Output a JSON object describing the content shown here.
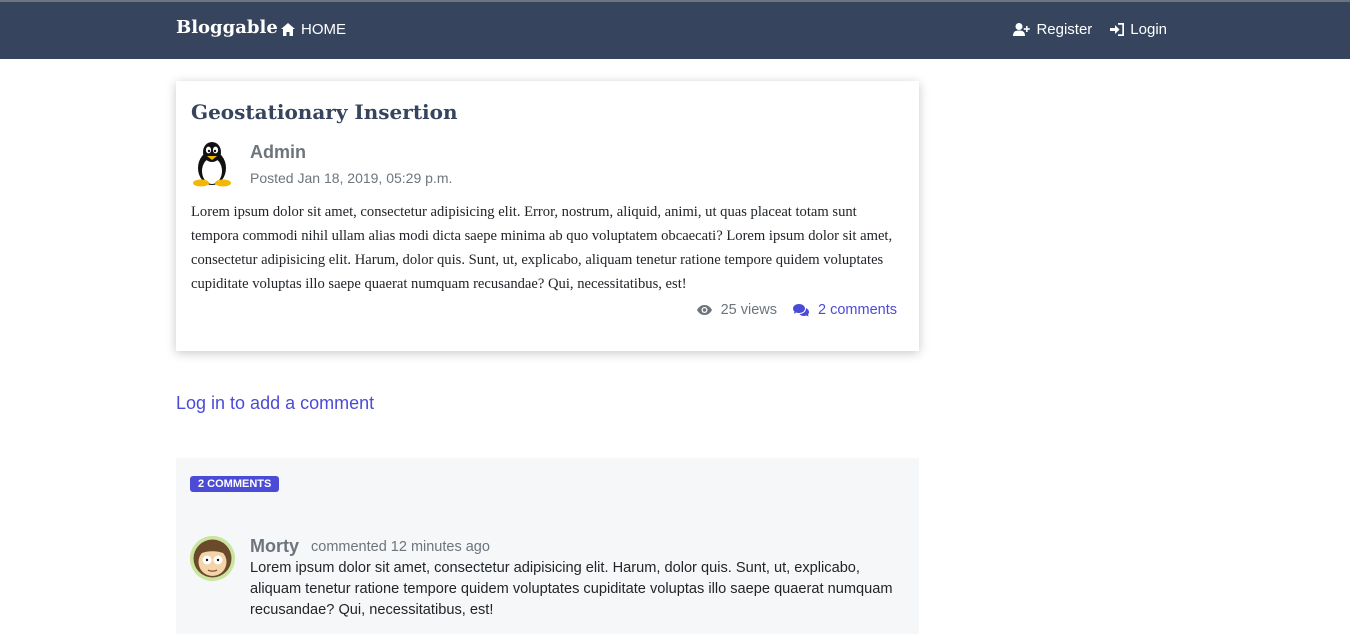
{
  "nav": {
    "brand": "Bloggable",
    "home": "HOME",
    "register": "Register",
    "login": "Login"
  },
  "post": {
    "title": "Geostationary Insertion",
    "author": "Admin",
    "posted": "Posted Jan 18, 2019, 05:29 p.m.",
    "body": "Lorem ipsum dolor sit amet, consectetur adipisicing elit. Error, nostrum, aliquid, animi, ut quas placeat totam sunt tempora commodi nihil ullam alias modi dicta saepe minima ab quo voluptatem obcaecati? Lorem ipsum dolor sit amet, consectetur adipisicing elit. Harum, dolor quis. Sunt, ut, explicabo, aliquam tenetur ratione tempore quidem voluptates cupiditate voluptas illo saepe quaerat numquam recusandae? Qui, necessitatibus, est!",
    "views": "25 views",
    "comments_link": "2 comments"
  },
  "login_prompt": "Log in to add a comment",
  "comments": {
    "badge": "2 COMMENTS",
    "items": [
      {
        "author": "Morty",
        "when": "commented 12 minutes ago",
        "text": "Lorem ipsum dolor sit amet, consectetur adipisicing elit. Harum, dolor quis. Sunt, ut, explicabo, aliquam tenetur ratione tempore quidem voluptates cupiditate voluptas illo saepe quaerat numquam recusandae? Qui, necessitatibus, est!"
      }
    ]
  },
  "colors": {
    "navbar": "#36455d",
    "accent": "#4c4bd6",
    "muted": "#6c757d"
  }
}
